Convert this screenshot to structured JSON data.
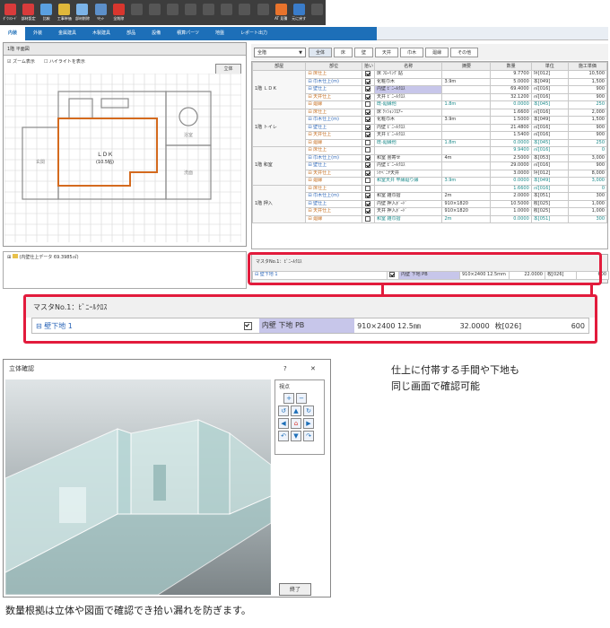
{
  "toolbar": [
    {
      "label": "ﾀﾞｳﾝﾛｰﾄﾞ",
      "color": "#d83b3b"
    },
    {
      "label": "部材設定",
      "color": "#d83b3b"
    },
    {
      "label": "比較",
      "color": "#5aa0e0"
    },
    {
      "label": "工事単価",
      "color": "#e0b83a"
    },
    {
      "label": "部材削除",
      "color": "#7bb3e8"
    },
    {
      "label": "ﾘｾｯﾄ",
      "color": "#5c8fc9"
    },
    {
      "label": "全削除",
      "color": "#d8362e"
    },
    {
      "label": "",
      "color": "#888888"
    },
    {
      "label": "",
      "color": "#888888"
    },
    {
      "label": "",
      "color": "#888888"
    },
    {
      "label": "",
      "color": "#888888"
    },
    {
      "label": "",
      "color": "#888888"
    },
    {
      "label": "",
      "color": "#888888"
    },
    {
      "label": "",
      "color": "#888888"
    },
    {
      "label": "",
      "color": "#888888"
    },
    {
      "label": "AT 見積",
      "color": "#e8732c"
    },
    {
      "label": "元に戻す",
      "color": "#3a7cc9"
    },
    {
      "label": "",
      "color": "#888888"
    }
  ],
  "tabs": [
    "内装",
    "外装",
    "金属建具",
    "木製建具",
    "部品",
    "設備",
    "積算パーツ",
    "地盤",
    "レポート出力"
  ],
  "plan": {
    "title": "1階 平面図",
    "zoom": "ズーム表示",
    "highlight": "ハイライトを表示",
    "button": "立体",
    "room": "ＬＤＫ",
    "room_area": "(10.5帖)",
    "left_room": "玄関",
    "right_room1": "浴室",
    "right_room2": "洗面"
  },
  "tree": {
    "text": "(内壁仕上データ 69.3985㎡)"
  },
  "filter": {
    "value": "全階",
    "tabs": [
      "全体",
      "床",
      "壁",
      "天井",
      "巾木",
      "廻縁",
      "その他"
    ],
    "active": 0
  },
  "grid": {
    "headers": [
      "部屋",
      "部位",
      "拾い",
      "名称",
      "摘要",
      "数量",
      "単位",
      "施工単価"
    ],
    "rooms": [
      {
        "name": "1階 ＬＤＫ",
        "rows": [
          [
            "床仕上",
            "on",
            "床 ﾌﾛｰﾘﾝｸﾞ貼",
            "",
            "9.7700",
            "坪[012]",
            "10,500",
            ""
          ],
          [
            "巾木仕上(m)",
            "on",
            "化粧巾木",
            "3.9m",
            "5.0000",
            "本[049]",
            "1,500",
            ""
          ],
          [
            "壁仕上",
            "on",
            "内壁 ﾋﾞﾆｰﾙｸﾛｽ",
            "",
            "69.4000",
            "㎡[016]",
            "900",
            "hl"
          ],
          [
            "天井仕上",
            "on",
            "天井 ﾋﾞﾆｰﾙｸﾛｽ",
            "",
            "32.1200",
            "㎡[016]",
            "900",
            ""
          ],
          [
            "廻縁",
            "",
            "既-廻縁他",
            "1.8m",
            "0.0000",
            "本[045]",
            "250",
            "teal"
          ]
        ]
      },
      {
        "name": "1階 トイレ",
        "rows": [
          [
            "床仕上",
            "on",
            "床 ｸｯｼｮﾝﾌﾛｱｰ",
            "",
            "1.6600",
            "㎡[016]",
            "2,000",
            ""
          ],
          [
            "巾木仕上(m)",
            "on",
            "化粧巾木",
            "3.9m",
            "1.5000",
            "本[049]",
            "1,500",
            ""
          ],
          [
            "壁仕上",
            "on",
            "内壁 ﾋﾞﾆｰﾙｸﾛｽ",
            "",
            "21.4800",
            "㎡[016]",
            "900",
            ""
          ],
          [
            "天井仕上",
            "on",
            "天井 ﾋﾞﾆｰﾙｸﾛｽ",
            "",
            "1.5400",
            "㎡[016]",
            "900",
            ""
          ],
          [
            "廻縁",
            "",
            "既-廻縁他",
            "1.8m",
            "0.0000",
            "本[045]",
            "250",
            "teal"
          ]
        ]
      },
      {
        "name": "1階 和室",
        "rows": [
          [
            "床仕上",
            "",
            "",
            "",
            "9.9400",
            "㎡[016]",
            "0",
            "teal"
          ],
          [
            "巾木仕上(m)",
            "on",
            "和室 畳寄せ",
            "4m",
            "2.5000",
            "本[053]",
            "3,000",
            ""
          ],
          [
            "壁仕上",
            "on",
            "内壁 ﾋﾞﾆｰﾙｸﾛｽ",
            "",
            "29.0000",
            "㎡[016]",
            "900",
            ""
          ],
          [
            "天井仕上",
            "on",
            "ｼﾅﾍﾞﾆﾔ天井",
            "",
            "3.0000",
            "坪[012]",
            "8,000",
            ""
          ],
          [
            "廻縁",
            "",
            "和室天井 竿縁廻り縁",
            "3.9m",
            "0.0000",
            "本[049]",
            "3,000",
            "teal"
          ]
        ]
      },
      {
        "name": "1階 押入",
        "rows": [
          [
            "床仕上",
            "",
            "",
            "",
            "1.6600",
            "㎡[016]",
            "0",
            "teal"
          ],
          [
            "巾木仕上(m)",
            "on",
            "和室 雑巾摺",
            "2m",
            "2.0000",
            "本[051]",
            "300",
            ""
          ],
          [
            "壁仕上",
            "on",
            "内壁 押入ﾎﾞｰﾄﾞ",
            "910×1820",
            "10.5000",
            "枚[025]",
            "1,000",
            ""
          ],
          [
            "天井仕上",
            "on",
            "天井 押入ﾎﾞｰﾄﾞ",
            "910×1820",
            "1.0000",
            "枚[025]",
            "1,000",
            ""
          ],
          [
            "廻縁",
            "",
            "和室 雑巾摺",
            "2m",
            "0.0000",
            "本[051]",
            "300",
            "teal"
          ]
        ]
      }
    ]
  },
  "master": {
    "title": "マスタNo.1：ﾋﾞﾆｰﾙｸﾛｽ",
    "row": [
      "壁下地 1",
      "内壁 下地 PB",
      "910×2400 12.5mm",
      "22.0000",
      "枚[026]",
      "600"
    ]
  },
  "zoom": {
    "title": "マスタNo.1：ﾋﾞﾆｰﾙｸﾛｽ",
    "row": [
      "壁下地 1",
      "内壁 下地 PB",
      "910×2400 12.5㎜",
      "32.0000",
      "枚[026]",
      "600"
    ]
  },
  "dialog": {
    "title": "立体確認",
    "help": "?",
    "close_x": "✕",
    "viewpoint": "視点",
    "close_button": "終了"
  },
  "captions": {
    "right": "仕上に付帯する手間や下地も\n同じ画面で確認可能",
    "bottom": "数量根拠は立体や図面で確認でき拾い漏れを防ぎます。"
  },
  "colors": {
    "red": "#e21b3c",
    "tab_blue": "#1d6fb8"
  }
}
